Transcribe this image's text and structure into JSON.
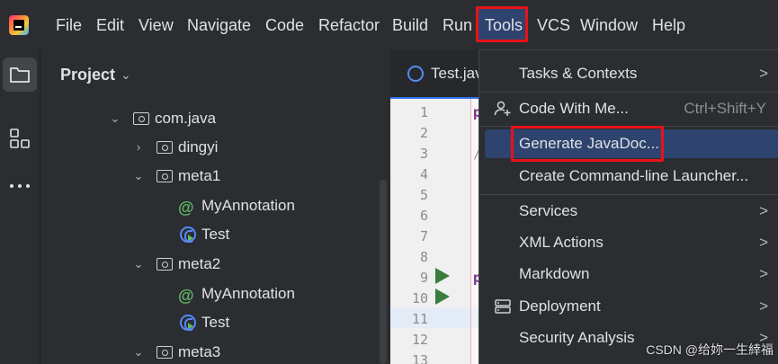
{
  "menubar": {
    "items": [
      "File",
      "Edit",
      "View",
      "Navigate",
      "Code",
      "Refactor",
      "Build",
      "Run",
      "Tools",
      "VCS",
      "Window",
      "Help"
    ],
    "active_item": "Tools",
    "icon": "intellij-logo-icon"
  },
  "toolstrip": {
    "icons": [
      "folder-icon",
      "structure-icon",
      "more-icon"
    ]
  },
  "project_panel": {
    "title": "Project",
    "tree": [
      {
        "label": "com.java",
        "type": "package",
        "expanded": true
      },
      {
        "label": "dingyi",
        "type": "package",
        "expanded": false
      },
      {
        "label": "meta1",
        "type": "package",
        "expanded": true
      },
      {
        "label": "MyAnnotation",
        "type": "annotation"
      },
      {
        "label": "Test",
        "type": "class"
      },
      {
        "label": "meta2",
        "type": "package",
        "expanded": true
      },
      {
        "label": "MyAnnotation",
        "type": "annotation"
      },
      {
        "label": "Test",
        "type": "class"
      },
      {
        "label": "meta3",
        "type": "package",
        "expanded": true
      }
    ]
  },
  "editor": {
    "tab_label": "Test.jav",
    "line_numbers": [
      "1",
      "2",
      "3",
      "4",
      "5",
      "6",
      "7",
      "8",
      "9",
      "10",
      "11",
      "12",
      "13"
    ],
    "current_line": "11",
    "run_lines": [
      "9",
      "10"
    ]
  },
  "tools_menu": {
    "items": [
      {
        "label": "Tasks & Contexts",
        "submenu": true,
        "arrow": ">"
      },
      {
        "label": "Code With Me...",
        "shortcut": "Ctrl+Shift+Y",
        "icon": "add-user-icon"
      },
      {
        "label": "Generate JavaDoc...",
        "selected": true
      },
      {
        "label": "Create Command-line Launcher..."
      },
      {
        "label": "Services",
        "submenu": true,
        "arrow": ">"
      },
      {
        "label": "XML Actions",
        "submenu": true,
        "arrow": ">"
      },
      {
        "label": "Markdown",
        "submenu": true,
        "arrow": ">"
      },
      {
        "label": "Deployment",
        "submenu": true,
        "arrow": ">",
        "icon": "server-icon"
      },
      {
        "label": "Security Analysis",
        "submenu": true,
        "arrow": ">"
      }
    ]
  },
  "colors": {
    "highlight_box": "#e8121a",
    "selection": "#2e436e",
    "background": "#2b2d30"
  },
  "watermark": "CSDN @给妳一生緈福"
}
